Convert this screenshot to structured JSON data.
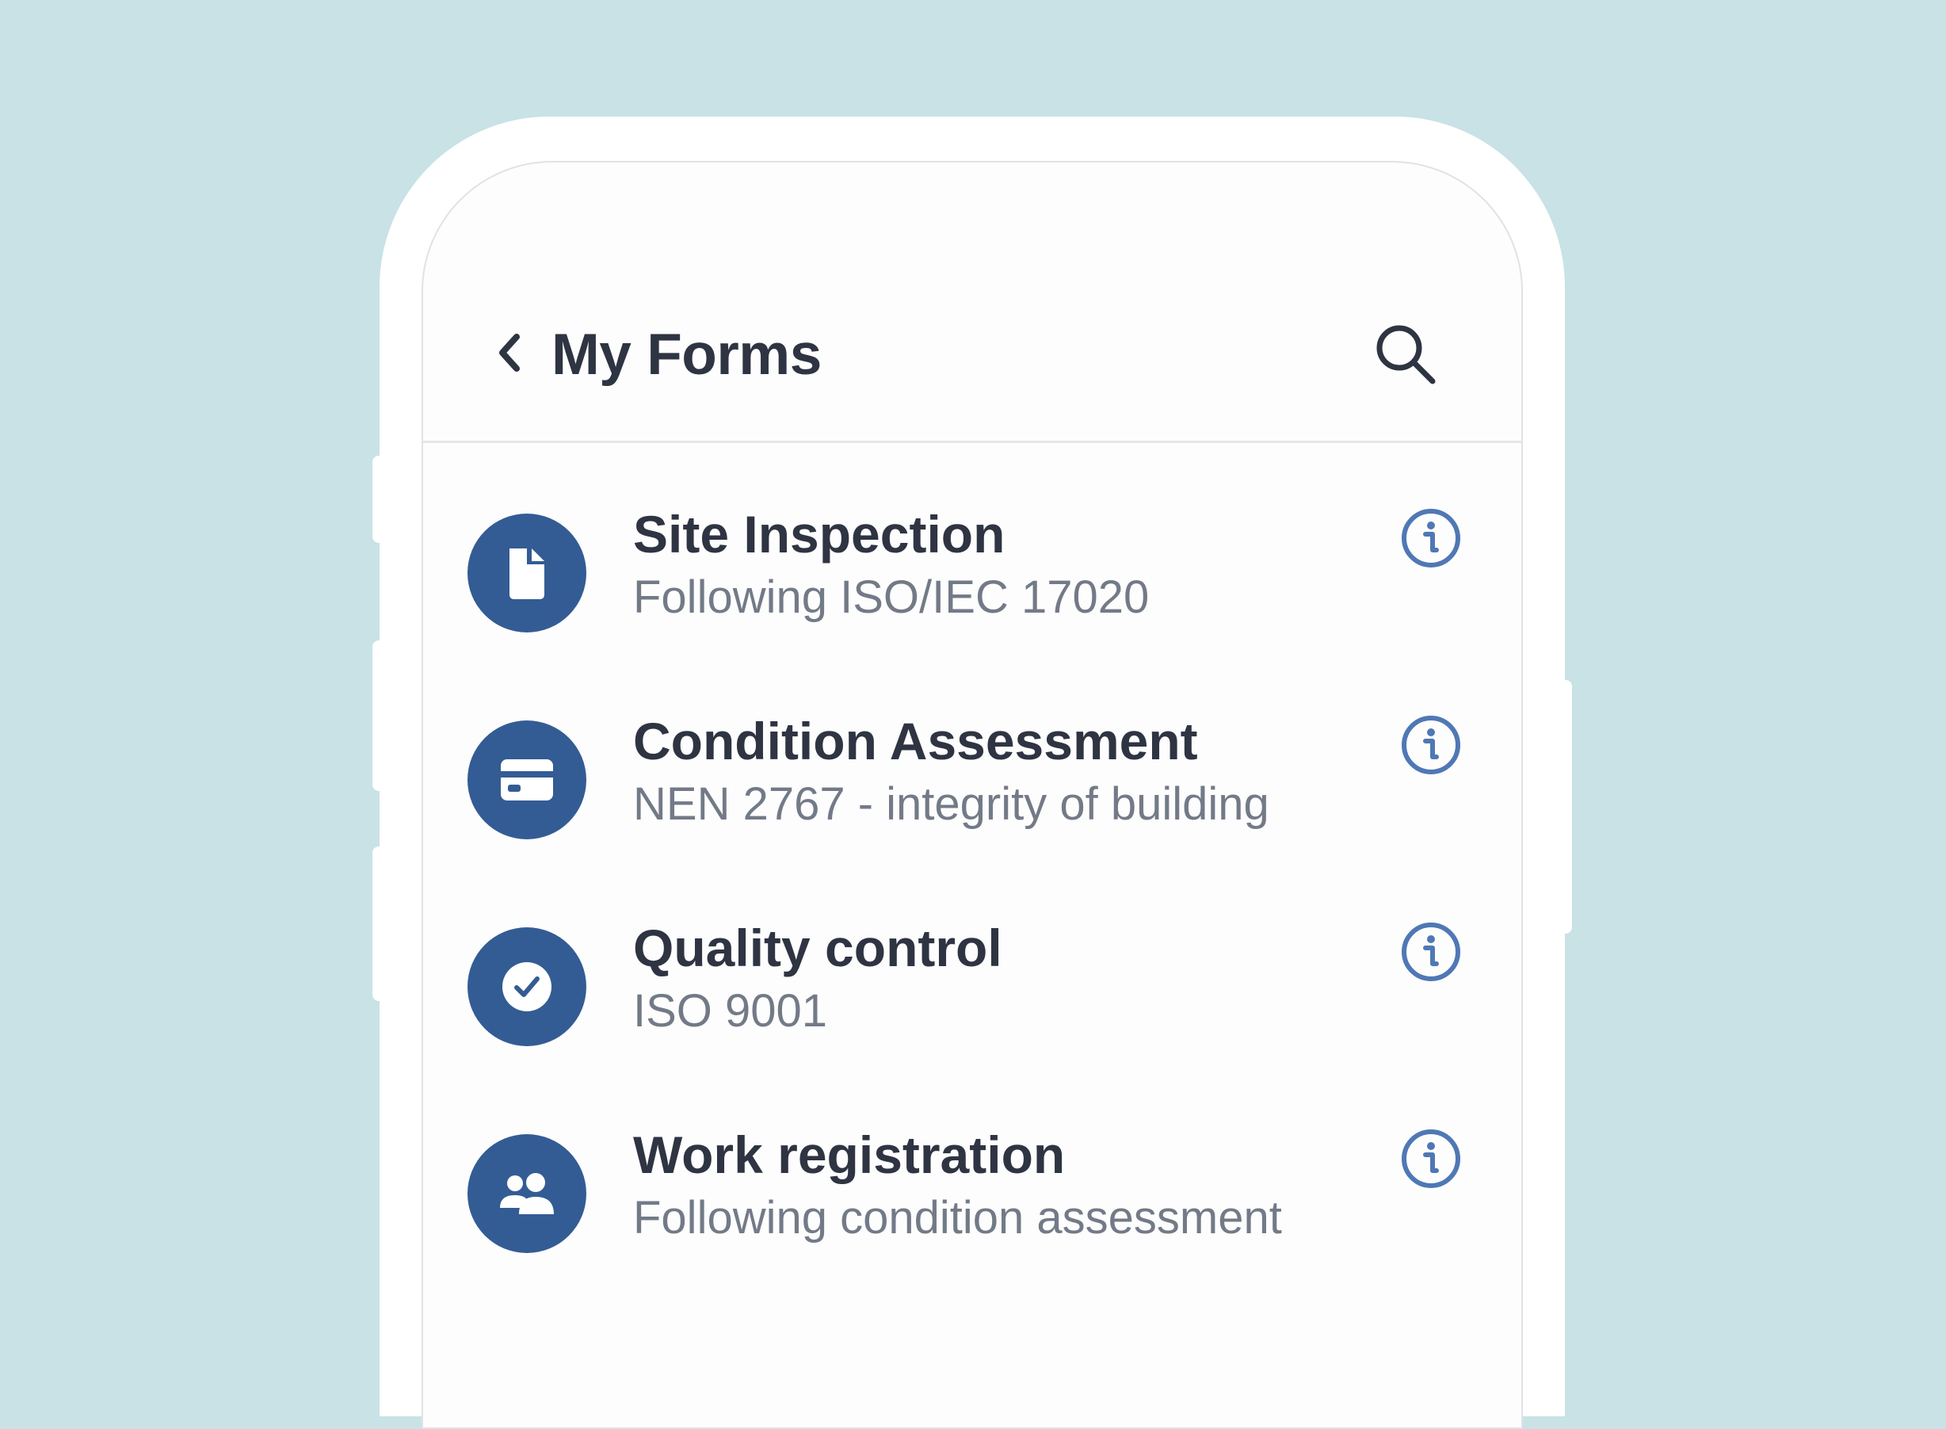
{
  "header": {
    "title": "My Forms",
    "back_icon": "chevron-left-icon",
    "search_icon": "search-icon"
  },
  "forms": [
    {
      "title": "Site Inspection",
      "subtitle": "Following ISO/IEC 17020",
      "icon": "document-icon"
    },
    {
      "title": "Condition Assessment",
      "subtitle": "NEN 2767 - integrity of building",
      "icon": "card-icon"
    },
    {
      "title": "Quality control",
      "subtitle": "ISO 9001",
      "icon": "check-circle-icon"
    },
    {
      "title": "Work registration",
      "subtitle": "Following condition assessment",
      "icon": "users-icon"
    }
  ],
  "colors": {
    "background": "#c8e2e5",
    "accent": "#335c94",
    "info": "#4f78b4",
    "title_text": "#2e3442",
    "subtitle_text": "#737a87"
  }
}
